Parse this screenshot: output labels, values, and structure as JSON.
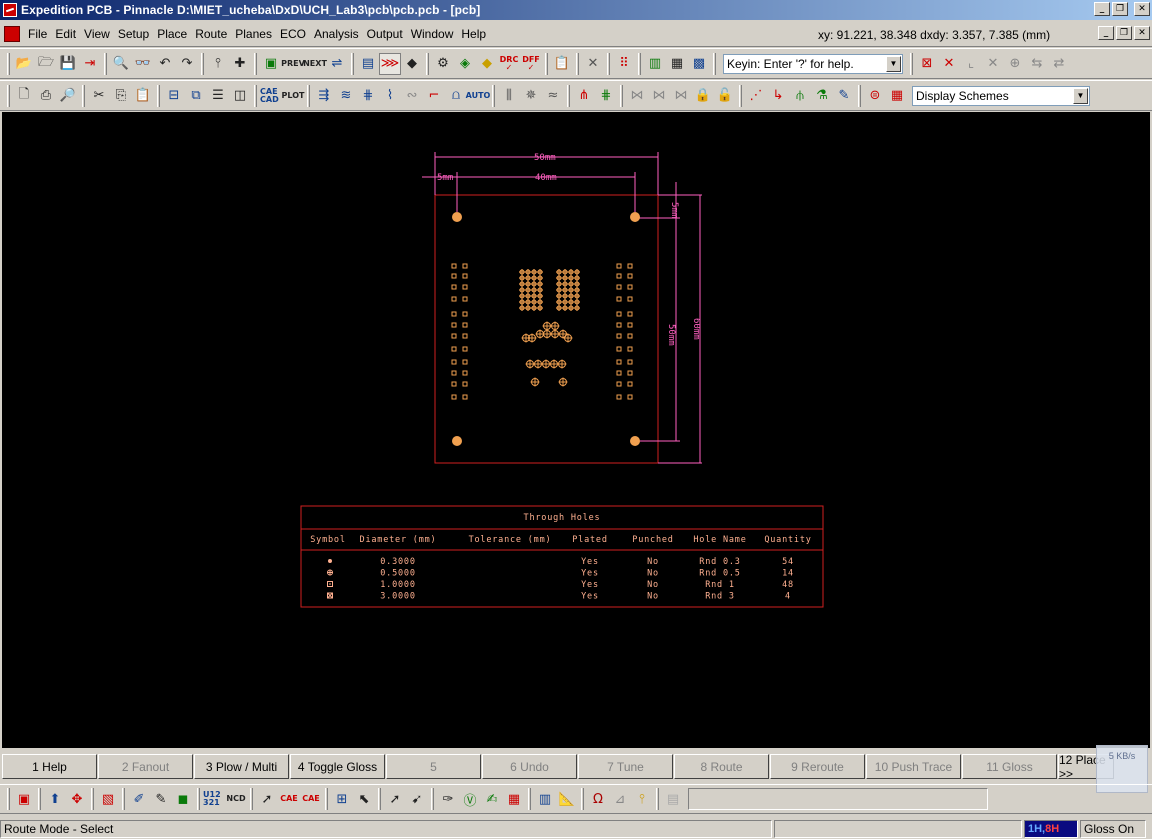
{
  "window": {
    "title": "Expedition PCB - Pinnacle  D:\\MIET_ucheba\\DxD\\UCH_Lab3\\pcb\\pcb.pcb - [pcb]"
  },
  "menu": {
    "items": [
      "File",
      "Edit",
      "View",
      "Setup",
      "Place",
      "Route",
      "Planes",
      "ECO",
      "Analysis",
      "Output",
      "Window",
      "Help"
    ],
    "coords": "xy: 91.221, 38.348  dxdy: 3.357, 7.385  (mm)"
  },
  "toolbar1": {
    "prev_label": "PREV",
    "next_label": "NEXT",
    "drc_label": "DRC",
    "diff_label": "DFF",
    "keyin_value": "Keyin: Enter '?' for help."
  },
  "toolbar2": {
    "cae_cad_label": "CAE CAD",
    "plot_label": "PLOT",
    "auto_label": "AUTO",
    "display_schemes_value": "Display Schemes"
  },
  "board": {
    "dimensions": {
      "width_outer": "50mm",
      "width_inner": "40mm",
      "left_offset": "5mm",
      "top_offset": "5mm",
      "height_inner": "50mm",
      "height_outer": "60mm"
    }
  },
  "hole_table": {
    "title": "Through Holes",
    "headers": [
      "Symbol",
      "Diameter (mm)",
      "Tolerance (mm)",
      "Plated",
      "Punched",
      "Hole Name",
      "Quantity"
    ],
    "rows": [
      {
        "symbol": "dot",
        "diameter": "0.3000",
        "tolerance": "",
        "plated": "Yes",
        "punched": "No",
        "name": "Rnd 0.3",
        "qty": "54"
      },
      {
        "symbol": "crosscircle",
        "diameter": "0.5000",
        "tolerance": "",
        "plated": "Yes",
        "punched": "No",
        "name": "Rnd 0.5",
        "qty": "14"
      },
      {
        "symbol": "squaredot",
        "diameter": "1.0000",
        "tolerance": "",
        "plated": "Yes",
        "punched": "No",
        "name": "Rnd 1",
        "qty": "48"
      },
      {
        "symbol": "squarex",
        "diameter": "3.0000",
        "tolerance": "",
        "plated": "Yes",
        "punched": "No",
        "name": "Rnd 3",
        "qty": "4"
      }
    ]
  },
  "fkeys": [
    "1 Help",
    "2 Fanout",
    "3 Plow / Multi",
    "4 Toggle Gloss",
    "5",
    "6 Undo",
    "7 Tune",
    "8 Route",
    "9 Reroute",
    "10 Push Trace",
    "11 Gloss",
    "12 Place >>"
  ],
  "bottom_toolbar": {
    "ncd_label": "NCD",
    "cae_label": "CAE",
    "label_u12": "U12 321"
  },
  "status": {
    "mode": "Route Mode - Select",
    "layers_prefix": "1H, ",
    "layers_suffix": "8H",
    "gloss": "Gloss On"
  },
  "net_badge": "5 KB/s",
  "colors": {
    "board_outline": "#d02020",
    "dimension": "#ff60c0",
    "pads": "#f0a050",
    "table_text": "#ffb090"
  }
}
